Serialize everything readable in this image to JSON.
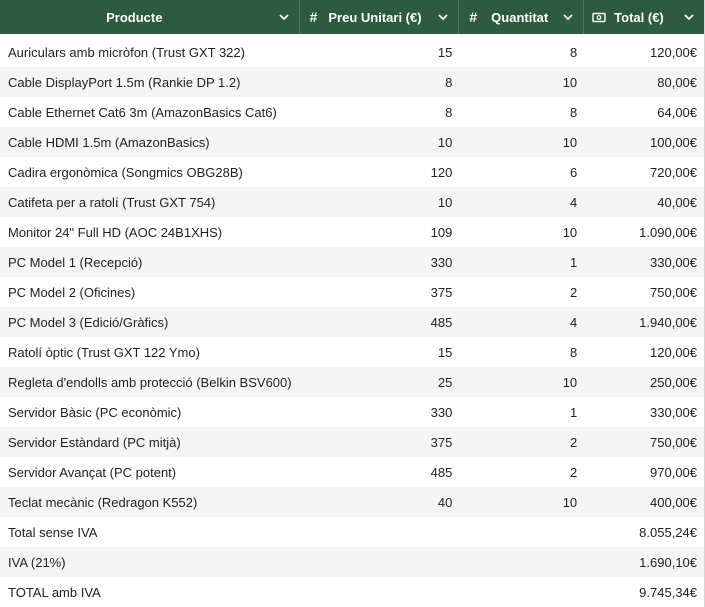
{
  "table": {
    "columns": [
      {
        "key": "product",
        "label": "Producte",
        "type_icon": "",
        "sort_icon": "chevron-down-icon"
      },
      {
        "key": "price",
        "label": "Preu Unitari (€)",
        "type_icon": "#",
        "sort_icon": "chevron-down-icon"
      },
      {
        "key": "qty",
        "label": "Quantitat",
        "type_icon": "#",
        "sort_icon": "chevron-down-icon"
      },
      {
        "key": "total",
        "label": "Total (€)",
        "type_icon": "money-icon",
        "sort_icon": "chevron-down-icon"
      }
    ],
    "rows": [
      {
        "product": "Auriculars amb micròfon (Trust GXT 322)",
        "price": "15",
        "qty": "8",
        "total": "120,00€"
      },
      {
        "product": "Cable DisplayPort 1.5m (Rankie DP 1.2)",
        "price": "8",
        "qty": "10",
        "total": "80,00€"
      },
      {
        "product": "Cable Ethernet Cat6 3m (AmazonBasics Cat6)",
        "price": "8",
        "qty": "8",
        "total": "64,00€"
      },
      {
        "product": "Cable HDMI 1.5m (AmazonBasics)",
        "price": "10",
        "qty": "10",
        "total": "100,00€"
      },
      {
        "product": "Cadira ergonòmica (Songmics OBG28B)",
        "price": "120",
        "qty": "6",
        "total": "720,00€"
      },
      {
        "product": "Catifeta per a ratolí (Trust GXT 754)",
        "price": "10",
        "qty": "4",
        "total": "40,00€"
      },
      {
        "product": "Monitor 24\" Full HD (AOC 24B1XHS)",
        "price": "109",
        "qty": "10",
        "total": "1.090,00€"
      },
      {
        "product": "PC Model 1 (Recepció)",
        "price": "330",
        "qty": "1",
        "total": "330,00€"
      },
      {
        "product": "PC Model 2 (Oficines)",
        "price": "375",
        "qty": "2",
        "total": "750,00€"
      },
      {
        "product": "PC Model 3 (Edició/Gràfics)",
        "price": "485",
        "qty": "4",
        "total": "1.940,00€"
      },
      {
        "product": "Ratolí òptic (Trust GXT 122 Ymo)",
        "price": "15",
        "qty": "8",
        "total": "120,00€"
      },
      {
        "product": "Regleta d'endolls amb protecció (Belkin BSV600)",
        "price": "25",
        "qty": "10",
        "total": "250,00€"
      },
      {
        "product": "Servidor Bàsic (PC econòmic)",
        "price": "330",
        "qty": "1",
        "total": "330,00€"
      },
      {
        "product": "Servidor Estàndard (PC mitjà)",
        "price": "375",
        "qty": "2",
        "total": "750,00€"
      },
      {
        "product": "Servidor Avançat (PC potent)",
        "price": "485",
        "qty": "2",
        "total": "970,00€"
      },
      {
        "product": "Teclat mecànic (Redragon K552)",
        "price": "40",
        "qty": "10",
        "total": "400,00€"
      },
      {
        "product": "Total sense IVA",
        "price": "",
        "qty": "",
        "total": "8.055,24€"
      },
      {
        "product": "IVA (21%)",
        "price": "",
        "qty": "",
        "total": "1.690,10€"
      },
      {
        "product": "TOTAL amb IVA",
        "price": "",
        "qty": "",
        "total": "9.745,34€"
      }
    ]
  },
  "colors": {
    "header_bg": "#2e5a3f",
    "header_text": "#ffffff",
    "row_alt_bg": "#f4f5f4",
    "text": "#222222"
  }
}
